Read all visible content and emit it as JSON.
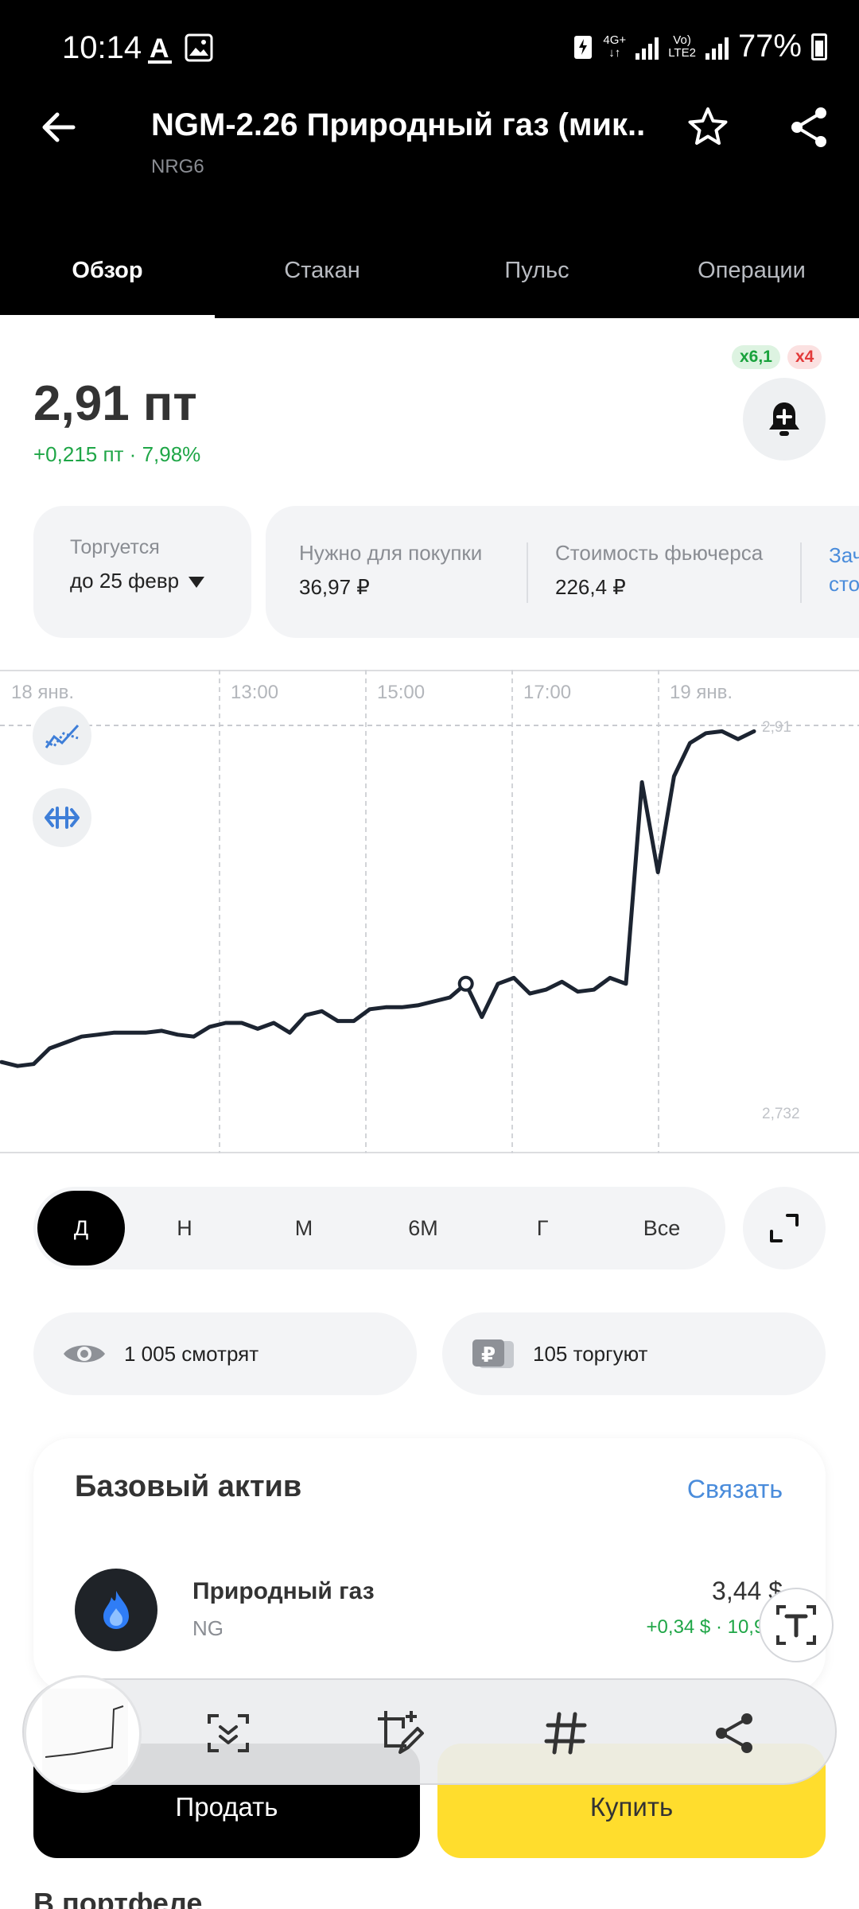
{
  "status_bar": {
    "time": "10:14",
    "network_top": "4G+",
    "network_second_a": "Vo)",
    "network_second_b": "LTE2",
    "battery": "77%"
  },
  "header": {
    "title": "NGM-2.26 Природный газ (мик..",
    "ticker": "NRG6",
    "back_icon": "arrow-left-icon",
    "favorite_icon": "star-icon",
    "share_icon": "share-icon"
  },
  "tabs": [
    {
      "label": "Обзор",
      "active": true
    },
    {
      "label": "Стакан",
      "active": false
    },
    {
      "label": "Пульс",
      "active": false
    },
    {
      "label": "Операции",
      "active": false
    }
  ],
  "price": {
    "value": "2,91 пт",
    "change": "+0,215 пт · 7,98%",
    "leverage_long": "x6,1",
    "leverage_short": "x4",
    "alert_icon": "bell-plus-icon"
  },
  "trading": {
    "label": "Торгуется",
    "value": "до 25 февр"
  },
  "info": [
    {
      "label": "Нужно для покупки",
      "value": "36,97 ₽"
    },
    {
      "label": "Стоимость фьючерса",
      "value": "226,4 ₽"
    }
  ],
  "info_more": [
    "Зач",
    "сто"
  ],
  "chart_data": {
    "type": "line",
    "x_labels": [
      "18 янв.",
      "13:00",
      "15:00",
      "17:00",
      "19 янв."
    ],
    "y_top_label": "2,91",
    "y_bottom_label": "2,732",
    "ylim": [
      2.732,
      2.91
    ],
    "series": [
      {
        "values": [
          2.738,
          2.736,
          2.737,
          2.745,
          2.748,
          2.751,
          2.752,
          2.753,
          2.753,
          2.753,
          2.754,
          2.752,
          2.751,
          2.756,
          2.758,
          2.758,
          2.755,
          2.758,
          2.753,
          2.762,
          2.764,
          2.759,
          2.759,
          2.765,
          2.766,
          2.766,
          2.767,
          2.769,
          2.771,
          2.778,
          2.761,
          2.778,
          2.781,
          2.773,
          2.775,
          2.779,
          2.774,
          2.775,
          2.781,
          2.778,
          2.881,
          2.835,
          2.884,
          2.901,
          2.906,
          2.907,
          2.903,
          2.907
        ]
      }
    ],
    "grid": true,
    "tool_icons": [
      "indicators-icon",
      "compare-icon"
    ]
  },
  "periods": [
    {
      "label": "Д",
      "active": true
    },
    {
      "label": "Н",
      "active": false
    },
    {
      "label": "М",
      "active": false
    },
    {
      "label": "6М",
      "active": false
    },
    {
      "label": "Г",
      "active": false
    },
    {
      "label": "Все",
      "active": false
    }
  ],
  "expand_icon": "expand-icon",
  "social": {
    "watching": "1 005 смотрят",
    "trading": "105 торгуют",
    "watching_icon": "eye-icon",
    "trading_icon": "ruble-card-icon"
  },
  "base_asset": {
    "title": "Базовый актив",
    "link": "Связать",
    "name": "Природный газ",
    "code": "NG",
    "price": "3,44 $",
    "change": "+0,34 $ · 10,94%",
    "logo_icon": "flame-icon"
  },
  "actions": {
    "sell": "Продать",
    "buy": "Купить"
  },
  "portfolio_title": "В портфеле",
  "capture_toolbar": {
    "icons": [
      "scroll-capture-icon",
      "crop-edit-icon",
      "hashtag-icon",
      "share-icon"
    ],
    "ocr_icon": "text-extract-icon"
  },
  "colors": {
    "accent_green": "#1fa647",
    "accent_red": "#e33a3a",
    "link_blue": "#4a8cdb",
    "buy_yellow": "#ffdd2d",
    "line": "#1c2431"
  }
}
